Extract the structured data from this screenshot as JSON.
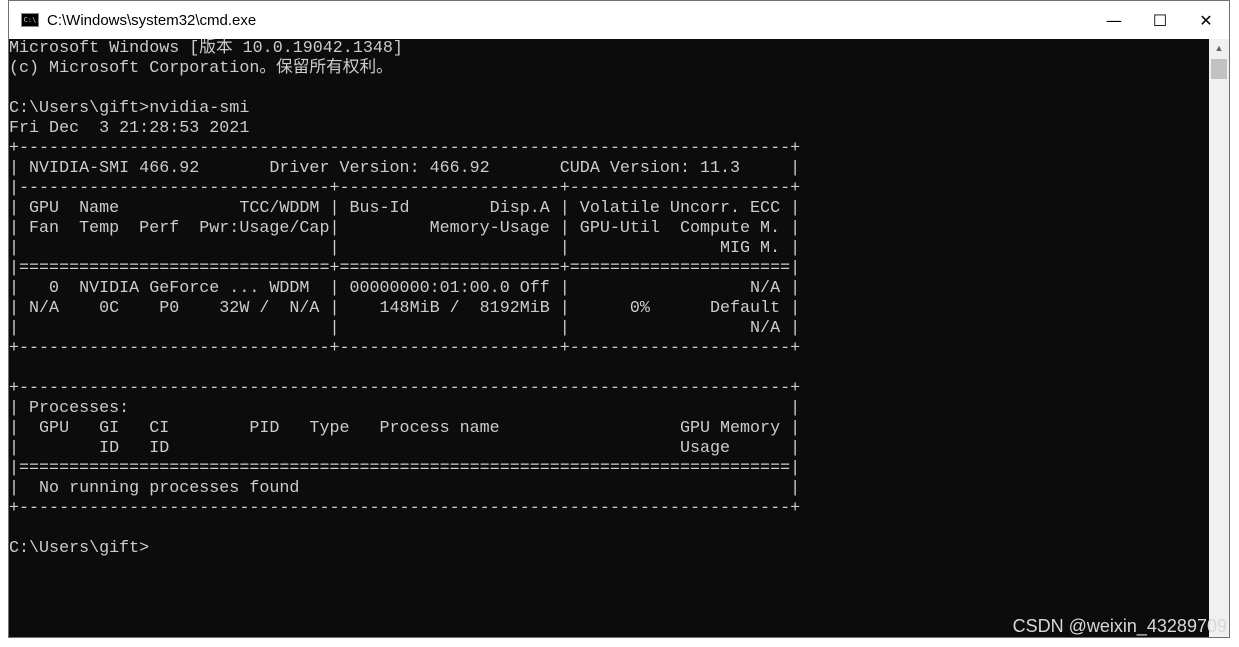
{
  "window": {
    "title": "C:\\Windows\\system32\\cmd.exe",
    "icon": "cmd-icon",
    "minimize": "—",
    "maximize": "☐",
    "close": "✕"
  },
  "terminal": {
    "lines": [
      "Microsoft Windows [版本 10.0.19042.1348]",
      "(c) Microsoft Corporation。保留所有权利。",
      "",
      "C:\\Users\\gift>nvidia-smi",
      "Fri Dec  3 21:28:53 2021",
      "+-----------------------------------------------------------------------------+",
      "| NVIDIA-SMI 466.92       Driver Version: 466.92       CUDA Version: 11.3     |",
      "|-------------------------------+----------------------+----------------------+",
      "| GPU  Name            TCC/WDDM | Bus-Id        Disp.A | Volatile Uncorr. ECC |",
      "| Fan  Temp  Perf  Pwr:Usage/Cap|         Memory-Usage | GPU-Util  Compute M. |",
      "|                               |                      |               MIG M. |",
      "|===============================+======================+======================|",
      "|   0  NVIDIA GeForce ... WDDM  | 00000000:01:00.0 Off |                  N/A |",
      "| N/A    0C    P0    32W /  N/A |    148MiB /  8192MiB |      0%      Default |",
      "|                               |                      |                  N/A |",
      "+-------------------------------+----------------------+----------------------+",
      "",
      "+-----------------------------------------------------------------------------+",
      "| Processes:                                                                  |",
      "|  GPU   GI   CI        PID   Type   Process name                  GPU Memory |",
      "|        ID   ID                                                   Usage      |",
      "|=============================================================================|",
      "|  No running processes found                                                 |",
      "+-----------------------------------------------------------------------------+",
      "",
      "C:\\Users\\gift>"
    ]
  },
  "watermark": "CSDN @weixin_43289709"
}
